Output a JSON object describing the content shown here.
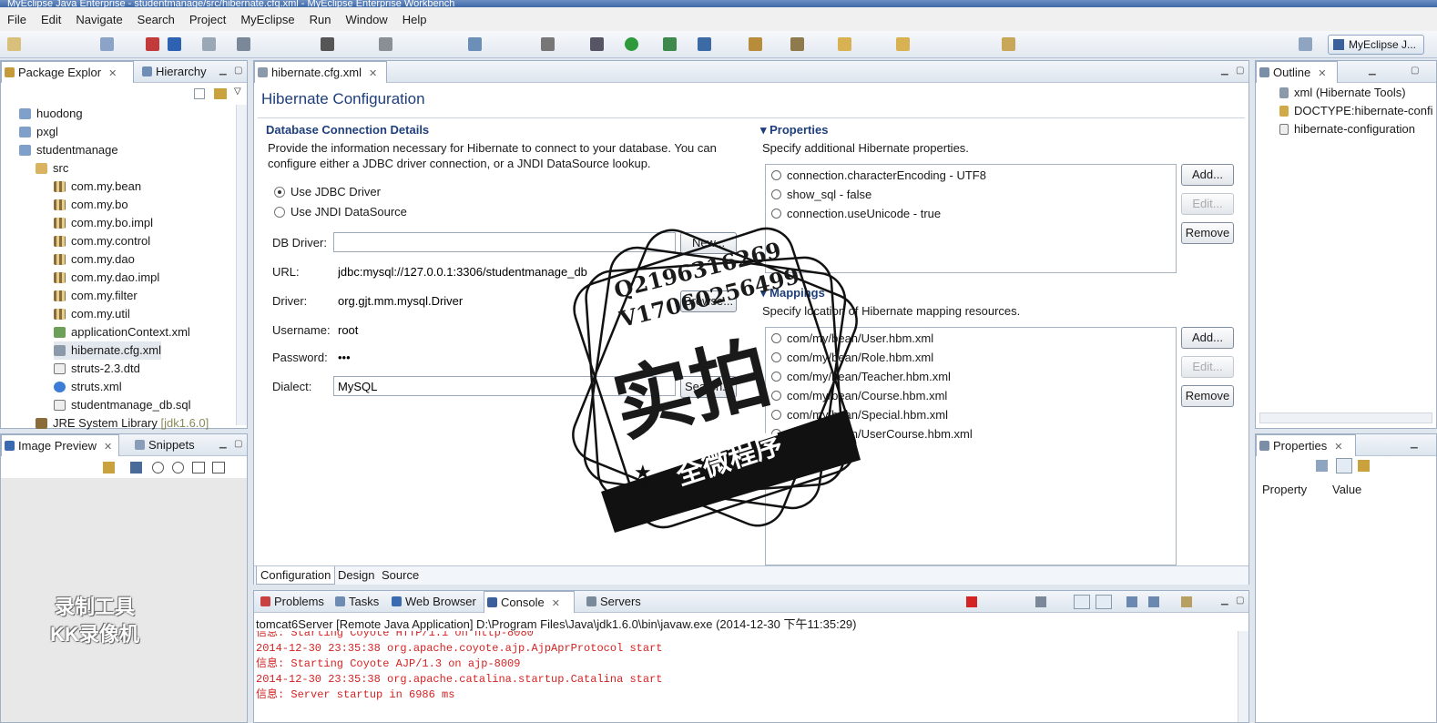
{
  "window": {
    "title": "MyEclipse Java Enterprise - studentmanage/src/hibernate.cfg.xml - MyEclipse Enterprise Workbench"
  },
  "menu": [
    "File",
    "Edit",
    "Navigate",
    "Search",
    "Project",
    "MyEclipse",
    "Run",
    "Window",
    "Help"
  ],
  "perspective": "MyEclipse J...",
  "package_explorer": {
    "tab1": "Package Explor",
    "tab2": "Hierarchy",
    "items": [
      {
        "label": "huodong"
      },
      {
        "label": "pxgl"
      },
      {
        "label": "studentmanage"
      },
      {
        "label": "src"
      },
      {
        "label": "com.my.bean"
      },
      {
        "label": "com.my.bo"
      },
      {
        "label": "com.my.bo.impl"
      },
      {
        "label": "com.my.control"
      },
      {
        "label": "com.my.dao"
      },
      {
        "label": "com.my.dao.impl"
      },
      {
        "label": "com.my.filter"
      },
      {
        "label": "com.my.util"
      },
      {
        "label": "applicationContext.xml"
      },
      {
        "label": "hibernate.cfg.xml"
      },
      {
        "label": "struts-2.3.dtd"
      },
      {
        "label": "struts.xml"
      },
      {
        "label": "studentmanage_db.sql"
      },
      {
        "label": "JRE System Library",
        "suffix": "[jdk1.6.0]"
      }
    ]
  },
  "image_preview": {
    "tab1": "Image Preview",
    "tab2": "Snippets"
  },
  "editor": {
    "tab": "hibernate.cfg.xml",
    "heading": "Hibernate  Configuration",
    "db": {
      "title": "Database Connection Details",
      "desc1": "Provide the information necessary for Hibernate to connect to your database.  You can",
      "desc2": "configure either a JDBC driver connection, or a JNDI DataSource lookup.",
      "radio1": "Use JDBC Driver",
      "radio2": "Use JNDI DataSource",
      "db_driver_label": "DB Driver:",
      "db_driver_value": "",
      "new_btn": "New...",
      "url_label": "URL:",
      "url_value": "jdbc:mysql://127.0.0.1:3306/studentmanage_db",
      "driver_label": "Driver:",
      "driver_value": "org.gjt.mm.mysql.Driver",
      "browse_btn": "Browse...",
      "username_label": "Username:",
      "username_value": "root",
      "password_label": "Password:",
      "password_value": "•••",
      "dialect_label": "Dialect:",
      "dialect_value": "MySQL",
      "search_btn": "Search..."
    },
    "properties": {
      "title": "Properties",
      "desc": "Specify additional Hibernate properties.",
      "items": [
        "connection.characterEncoding - UTF8",
        "show_sql - false",
        "connection.useUnicode - true"
      ],
      "add": "Add...",
      "edit": "Edit...",
      "remove": "Remove"
    },
    "mappings": {
      "title": "Mappings",
      "desc": "Specify location of Hibernate mapping resources.",
      "items": [
        "com/my/bean/User.hbm.xml",
        "com/my/bean/Role.hbm.xml",
        "com/my/bean/Teacher.hbm.xml",
        "com/my/bean/Course.hbm.xml",
        "com/my/bean/Special.hbm.xml",
        "com/my/bean/UserCourse.hbm.xml"
      ],
      "add": "Add...",
      "edit": "Edit...",
      "remove": "Remove"
    },
    "bottom_tabs": [
      "Configuration",
      "Design",
      "Source"
    ]
  },
  "outline": {
    "tab": "Outline",
    "items": [
      "xml (Hibernate Tools)",
      "DOCTYPE:hibernate-confi",
      "hibernate-configuration"
    ]
  },
  "props_view": {
    "tab": "Properties",
    "col1": "Property",
    "col2": "Value"
  },
  "console": {
    "tabs": [
      "Problems",
      "Tasks",
      "Web Browser",
      "Console",
      "Servers"
    ],
    "header": "tomcat6Server [Remote Java Application] D:\\Program Files\\Java\\jdk1.6.0\\bin\\javaw.exe (2014-12-30 下午11:35:29)",
    "lines": [
      "信息: Starting Coyote HTTP/1.1 on http-8080",
      "2014-12-30 23:35:38 org.apache.coyote.ajp.AjpAprProtocol start",
      "信息: Starting Coyote AJP/1.3 on ajp-8009",
      "2014-12-30 23:35:38 org.apache.catalina.startup.Catalina start",
      "信息: Server startup in 6986 ms"
    ]
  },
  "overlay": {
    "stamp_line1": "Q2196316269",
    "stamp_line2": "V17060256499",
    "stamp_big": "实拍",
    "stamp_banner": "全微程序",
    "recorder_line1": "录制工具",
    "recorder_line2": "KK录像机"
  },
  "colors": {
    "accent": "#1f3f7a",
    "console_text": "#d42323"
  }
}
